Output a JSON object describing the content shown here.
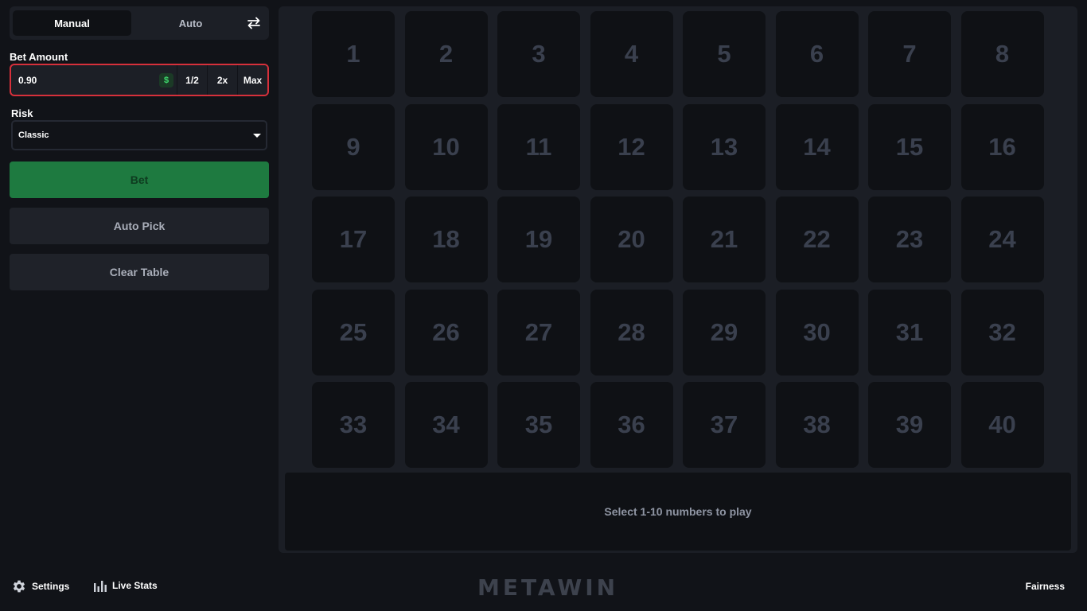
{
  "mode_tabs": [
    "Manual",
    "Auto"
  ],
  "active_mode": "Manual",
  "bet": {
    "label": "Bet Amount",
    "value": "0.90",
    "currency_symbol": "$",
    "half_label": "1/2",
    "double_label": "2x",
    "max_label": "Max"
  },
  "risk": {
    "label": "Risk",
    "selected": "Classic"
  },
  "buttons": {
    "bet": "Bet",
    "auto_pick": "Auto Pick",
    "clear_table": "Clear Table"
  },
  "tiles": [
    "1",
    "2",
    "3",
    "4",
    "5",
    "6",
    "7",
    "8",
    "9",
    "10",
    "11",
    "12",
    "13",
    "14",
    "15",
    "16",
    "17",
    "18",
    "19",
    "20",
    "21",
    "22",
    "23",
    "24",
    "25",
    "26",
    "27",
    "28",
    "29",
    "30",
    "31",
    "32",
    "33",
    "34",
    "35",
    "36",
    "37",
    "38",
    "39",
    "40"
  ],
  "info_message": "Select 1-10 numbers to play",
  "footer": {
    "settings": "Settings",
    "live_stats": "Live Stats",
    "logo": "METAWIN",
    "fairness": "Fairness"
  },
  "colors": {
    "accent_bet": "#1e7a40",
    "error_border": "#d6303b",
    "background": "#111318",
    "tile": "#0f1115"
  },
  "icons": [
    "swap-icon",
    "currency-icon",
    "chevron-down-icon",
    "gear-icon",
    "bar-chart-icon"
  ]
}
